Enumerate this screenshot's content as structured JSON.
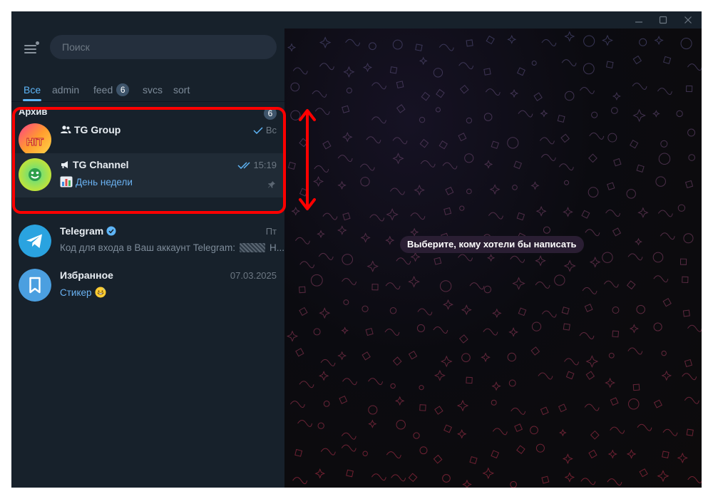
{
  "search": {
    "placeholder": "Поиск"
  },
  "tabs": [
    {
      "label": "Все"
    },
    {
      "label": "admin"
    },
    {
      "label": "feed",
      "badge": "6"
    },
    {
      "label": "svcs"
    },
    {
      "label": "sort"
    }
  ],
  "archive": {
    "label": "Архив",
    "count": "6"
  },
  "chats": [
    {
      "name": "TG Group",
      "time": "Вс",
      "preview": ""
    },
    {
      "name": "TG Channel",
      "time": "15:19",
      "preview": "День недели"
    },
    {
      "name": "Telegram",
      "time": "Пт",
      "preview": "Код для входа в Ваш аккаунт Telegram:",
      "preview_tail": "Н..."
    },
    {
      "name": "Избранное",
      "time": "07.03.2025",
      "preview": "Стикер"
    }
  ],
  "chat_area": {
    "hint": "Выберите, кому хотели бы написать"
  },
  "colors": {
    "sidebar_bg": "#17212b",
    "accent": "#5eb5f7",
    "highlight_box": "#ff0000",
    "telegram_blue": "#2aa3e0"
  },
  "icons": {
    "menu": "hamburger-icon",
    "minimize": "minimize-icon",
    "maximize": "maximize-icon",
    "close": "close-icon",
    "group": "group-icon",
    "channel": "megaphone-icon",
    "verified": "verified-badge-icon",
    "pin": "pin-icon",
    "saved": "bookmark-icon",
    "chart_emoji": "bar-chart-emoji",
    "sticker_emoji": "grinning-sweat-emoji"
  }
}
